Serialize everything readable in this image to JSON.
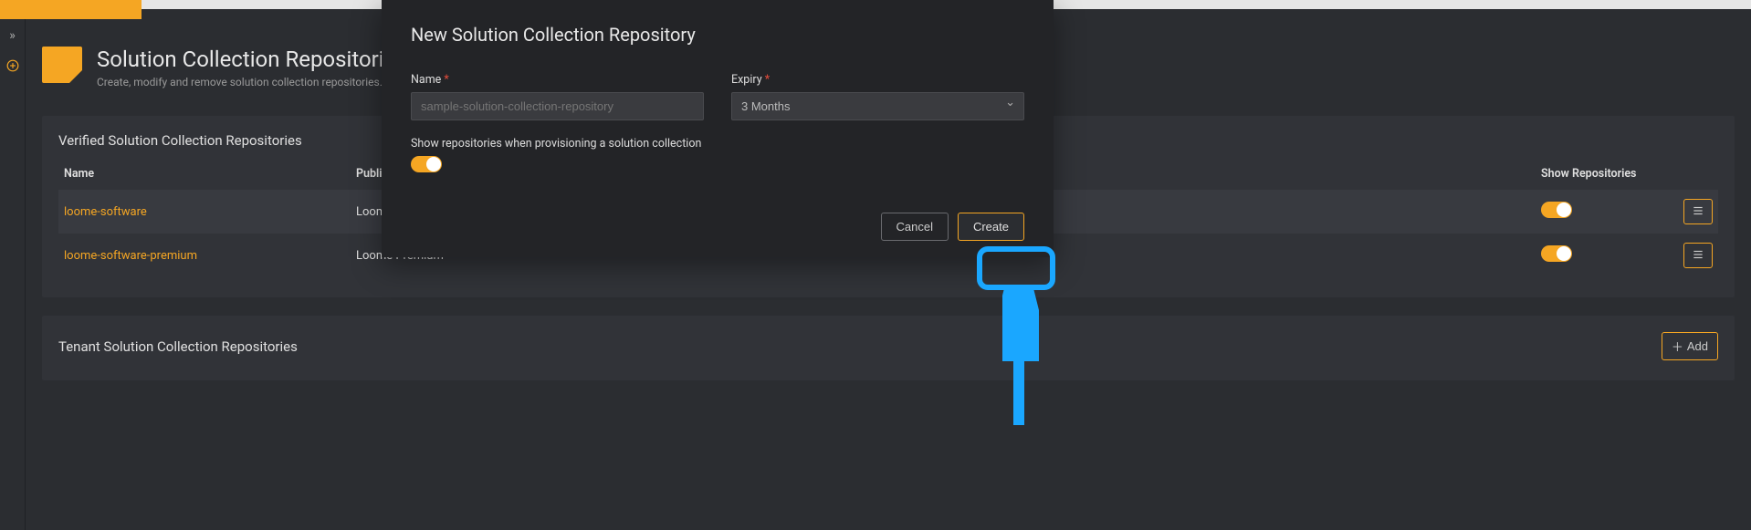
{
  "page": {
    "title": "Solution Collection Repositories",
    "subtitle": "Create, modify and remove solution collection repositories."
  },
  "verified": {
    "heading": "Verified Solution Collection Repositories",
    "columns": {
      "name": "Name",
      "publisher": "Publishers",
      "show": "Show Repositories"
    },
    "rows": [
      {
        "name": "loome-software",
        "publisher": "Loome Software"
      },
      {
        "name": "loome-software-premium",
        "publisher": "Loome Premium"
      }
    ]
  },
  "tenant": {
    "heading": "Tenant Solution Collection Repositories",
    "add_label": "Add"
  },
  "modal": {
    "title": "New Solution Collection Repository",
    "name_label": "Name",
    "name_placeholder": "sample-solution-collection-repository",
    "expiry_label": "Expiry",
    "expiry_value": "3 Months",
    "show_label": "Show repositories when provisioning a solution collection",
    "cancel_label": "Cancel",
    "create_label": "Create"
  }
}
